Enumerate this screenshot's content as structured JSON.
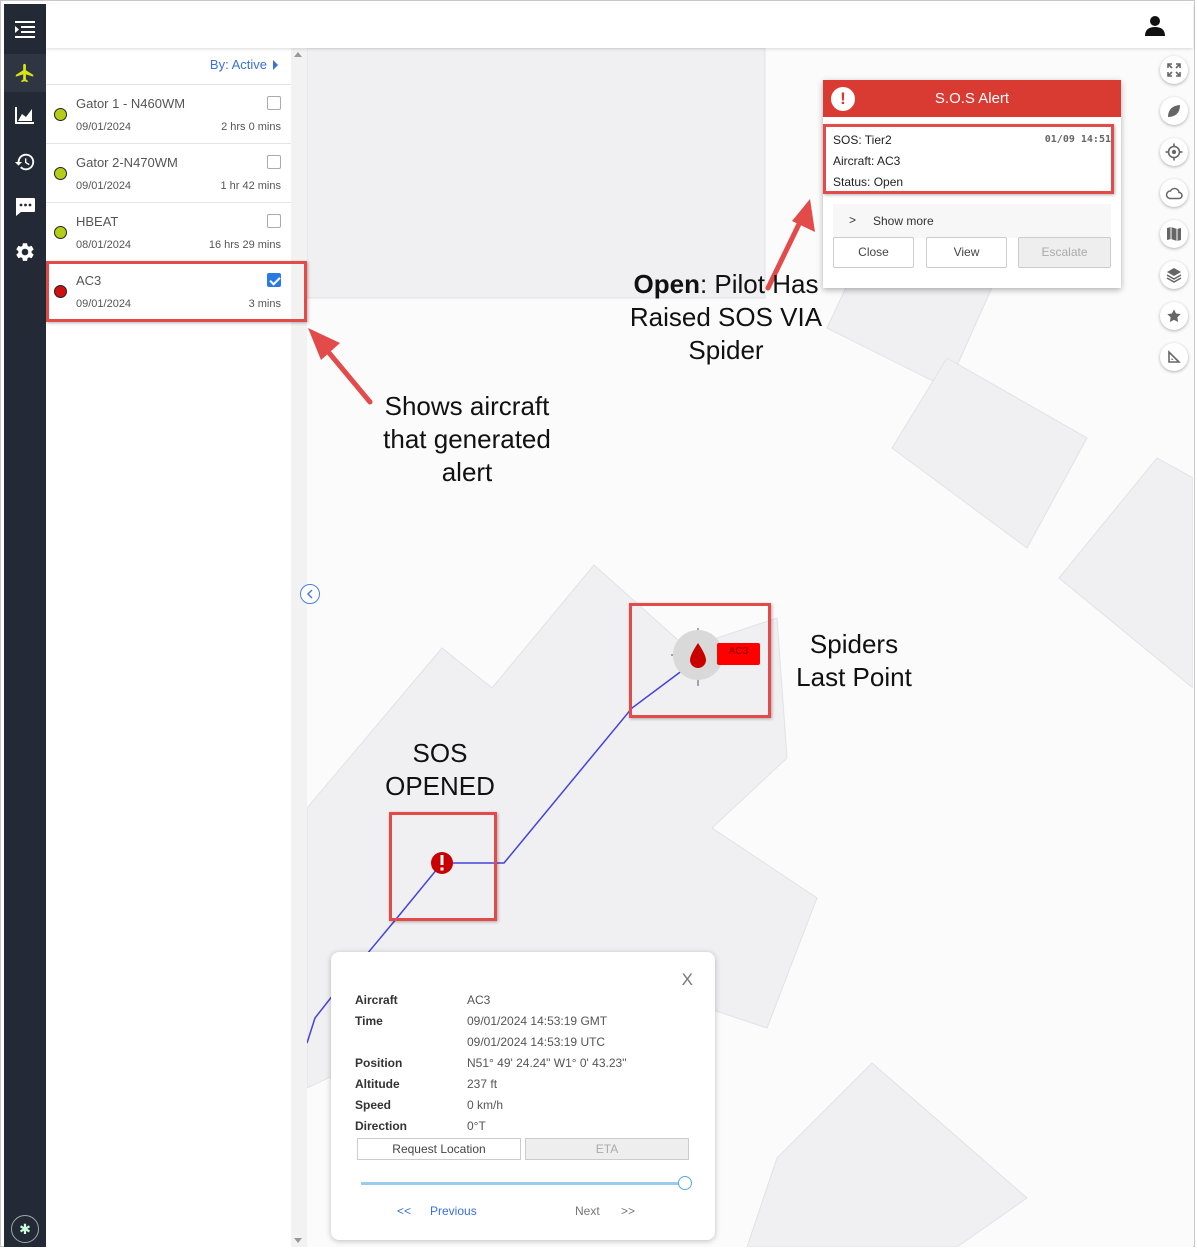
{
  "filter": {
    "label": "By: Active"
  },
  "aircraft": [
    {
      "name": "Gator 1 - N460WM",
      "date": "09/01/2024",
      "duration": "2 hrs 0 mins",
      "status_color": "#b5cc18",
      "checked": false
    },
    {
      "name": "Gator 2-N470WM",
      "date": "09/01/2024",
      "duration": "1 hr 42 mins",
      "status_color": "#b5cc18",
      "checked": false
    },
    {
      "name": "HBEAT",
      "date": "08/01/2024",
      "duration": "16 hrs 29 mins",
      "status_color": "#b5cc18",
      "checked": false
    },
    {
      "name": "AC3",
      "date": "09/01/2024",
      "duration": "3 mins",
      "status_color": "#d01010",
      "checked": true
    }
  ],
  "sos_alert": {
    "title": "S.O.S Alert",
    "icon": "alert-icon",
    "sos": "SOS: Tier2",
    "time": "01/09 14:51",
    "aircraft": "Aircraft: AC3",
    "status": "Status: Open",
    "show_more": "Show more",
    "close": "Close",
    "view": "View",
    "escalate": "Escalate",
    "accent": "#d93a32"
  },
  "map": {
    "marker_label": "AC3",
    "track_color": "#4343dd"
  },
  "info": {
    "close": "X",
    "aircraft_label": "Aircraft",
    "aircraft_value": "AC3",
    "time_label": "Time",
    "time_gmt": "09/01/2024 14:53:19 GMT",
    "time_utc": "09/01/2024 14:53:19 UTC",
    "position_label": "Position",
    "position_value": "N51° 49' 24.24\" W1° 0' 43.23\"",
    "altitude_label": "Altitude",
    "altitude_value": "237 ft",
    "speed_label": "Speed",
    "speed_value": "0 km/h",
    "direction_label": "Direction",
    "direction_value": "0°T",
    "request_location": "Request Location",
    "eta": "ETA",
    "slider_position": 1.0,
    "prev_arrows": "<<",
    "previous": "Previous",
    "next": "Next",
    "next_arrows": ">>"
  },
  "annotations": {
    "open_bold": "Open",
    "open_rest": ": Pilot Has Raised SOS VIA Spider",
    "shows_aircraft": "Shows aircraft that generated alert",
    "spiders_last_point": "Spiders Last Point",
    "sos_opened": "SOS OPENED",
    "color": "#e34a4a"
  }
}
